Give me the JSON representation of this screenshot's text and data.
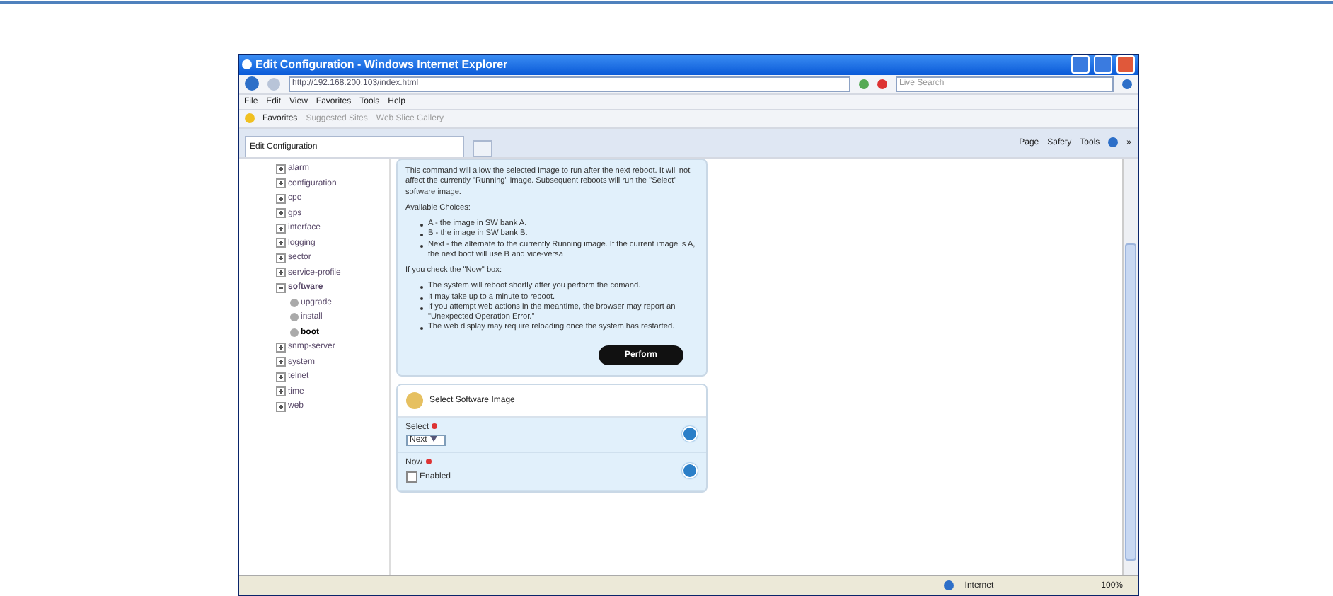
{
  "window": {
    "title": "Edit Configuration - Windows Internet Explorer"
  },
  "address": {
    "url": "http://192.168.200.103/index.html",
    "search_placeholder": "Live Search"
  },
  "menu": [
    "File",
    "Edit",
    "View",
    "Favorites",
    "Tools",
    "Help"
  ],
  "favorites_bar": {
    "favorites": "Favorites",
    "links": [
      "Suggested Sites",
      "Web Slice Gallery"
    ]
  },
  "tab": {
    "title": "Edit Configuration"
  },
  "command_bar": [
    "Page",
    "Safety",
    "Tools"
  ],
  "command_more": "»",
  "tree": [
    {
      "label": "alarm",
      "expanded": false,
      "selected": false
    },
    {
      "label": "configuration",
      "expanded": false,
      "selected": false
    },
    {
      "label": "cpe",
      "expanded": false,
      "selected": false
    },
    {
      "label": "gps",
      "expanded": false,
      "selected": false
    },
    {
      "label": "interface",
      "expanded": false,
      "selected": false
    },
    {
      "label": "logging",
      "expanded": false,
      "selected": false
    },
    {
      "label": "sector",
      "expanded": false,
      "selected": false
    },
    {
      "label": "service-profile",
      "expanded": false,
      "selected": false
    },
    {
      "label": "software",
      "expanded": true,
      "selected": false,
      "children": [
        {
          "label": "upgrade",
          "selected": false
        },
        {
          "label": "install",
          "selected": false
        },
        {
          "label": "boot",
          "selected": true
        }
      ]
    },
    {
      "label": "snmp-server",
      "expanded": false,
      "selected": false
    },
    {
      "label": "system",
      "expanded": false,
      "selected": false
    },
    {
      "label": "telnet",
      "expanded": false,
      "selected": false
    },
    {
      "label": "time",
      "expanded": false,
      "selected": false
    },
    {
      "label": "web",
      "expanded": false,
      "selected": false
    }
  ],
  "help": {
    "intro": "This command will allow the selected image to run after the next reboot. It will not affect the currently \"Running\" image. Subsequent reboots will run the \"Select\" software image.",
    "choices_title": "Available Choices:",
    "choices": [
      "A - the image in SW bank A.",
      "B - the image in SW bank B.",
      "Next - the alternate to the currently Running image. If the current image is A, the next boot will use B and vice-versa"
    ],
    "now_title": "If you check the \"Now\" box:",
    "now_items": [
      "The system will reboot shortly after you perform the comand.",
      "It may take up to a minute to reboot.",
      "If you attempt web actions in the meantime, the browser may report an \"Unexpected Operation Error.\"",
      "The web display may require reloading once the system has restarted."
    ],
    "button": "Perform"
  },
  "form": {
    "title": "Select Software Image",
    "fields": [
      {
        "kind": "select",
        "label": "Select",
        "required": true,
        "value": "Next"
      },
      {
        "kind": "checkbox",
        "label": "Now",
        "required": true,
        "option": "Enabled",
        "checked": false
      }
    ]
  },
  "status_bar": {
    "zone": "Internet",
    "zoom": "100%"
  }
}
